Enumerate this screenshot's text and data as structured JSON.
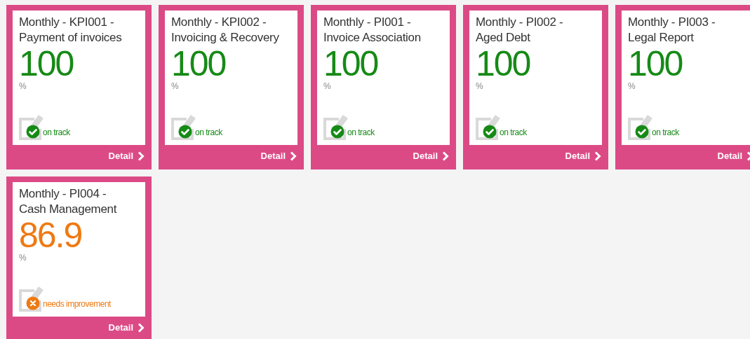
{
  "tiles": [
    {
      "title_line_1": "Monthly - KPI001 -",
      "title_line_2": "Payment of invoices",
      "value": "100",
      "unit": "%",
      "kind": "on_track",
      "status_text": "on track",
      "link": "Detail"
    },
    {
      "title_line_1": "Monthly - KPI002 -",
      "title_line_2": "Invoicing & Recovery",
      "value": "100",
      "unit": "%",
      "kind": "on_track",
      "status_text": "on track",
      "link": "Detail"
    },
    {
      "title_line_1": "Monthly - PI001 -",
      "title_line_2": "Invoice Association",
      "value": "100",
      "unit": "%",
      "kind": "on_track",
      "status_text": "on track",
      "link": "Detail"
    },
    {
      "title_line_1": "Monthly - PI002 -",
      "title_line_2": "Aged Debt",
      "value": "100",
      "unit": "%",
      "kind": "on_track",
      "status_text": "on track",
      "link": "Detail"
    },
    {
      "title_line_1": "Monthly - PI003 -",
      "title_line_2": "Legal Report",
      "value": "100",
      "unit": "%",
      "kind": "on_track",
      "status_text": "on track",
      "link": "Detail"
    },
    {
      "title_line_1": "Monthly - PI004 -",
      "title_line_2": "Cash Management",
      "value": "86.9",
      "unit": "%",
      "kind": "needs_improvement",
      "status_text": "needs improvement",
      "link": "Detail"
    }
  ]
}
